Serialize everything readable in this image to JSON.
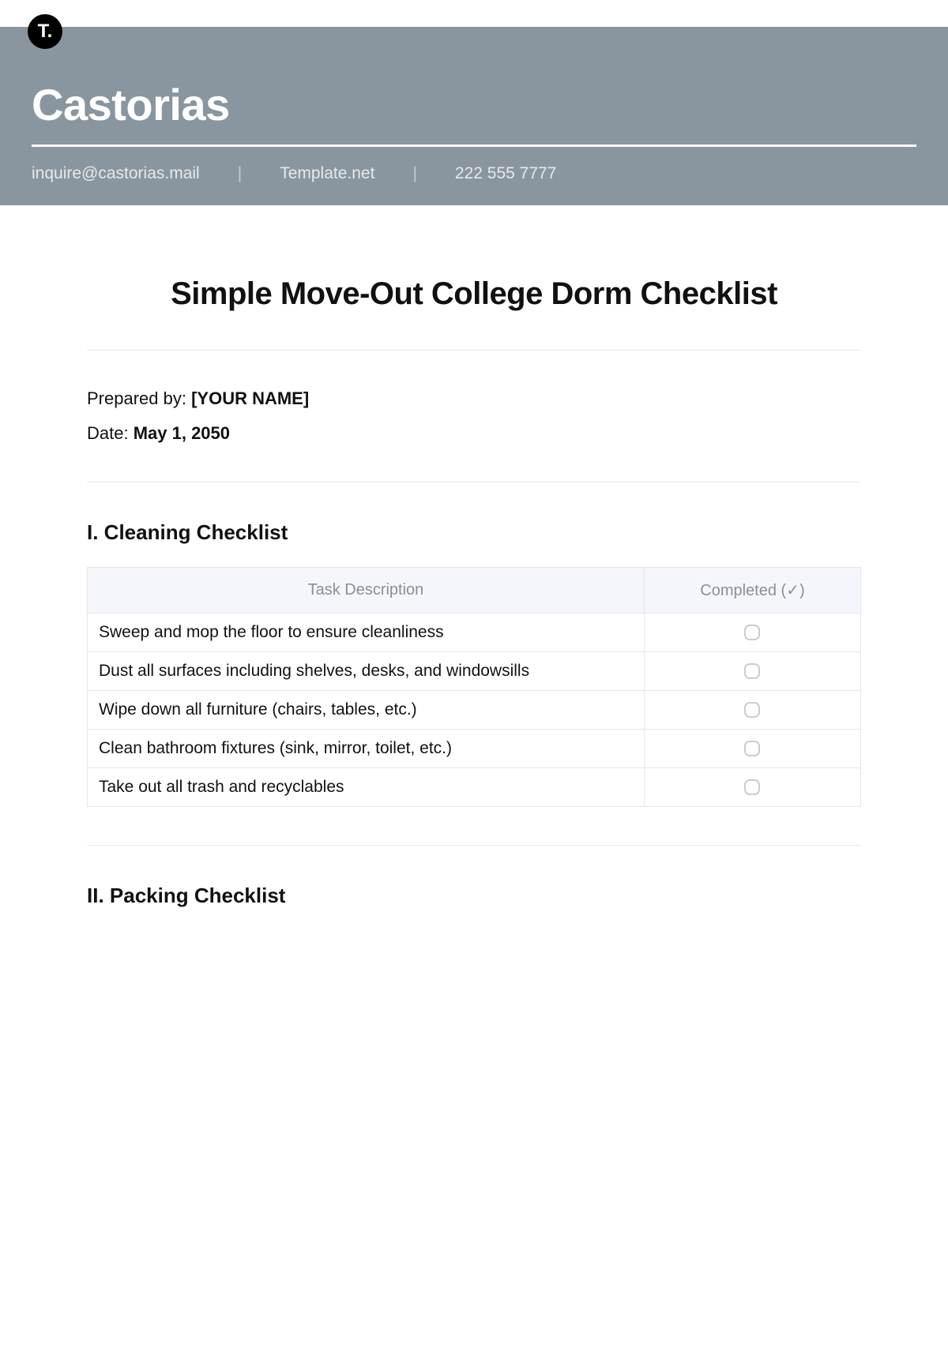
{
  "logo": {
    "text": "T."
  },
  "header": {
    "brand": "Castorias",
    "email": "inquire@castorias.mail",
    "website": "Template.net",
    "phone": "222 555 7777",
    "separator": "|"
  },
  "document": {
    "title": "Simple Move-Out College Dorm Checklist",
    "prepared_by_label": "Prepared by: ",
    "prepared_by_value": "[YOUR NAME]",
    "date_label": "Date: ",
    "date_value": "May 1, 2050"
  },
  "sections": {
    "cleaning": {
      "heading": "I. Cleaning Checklist",
      "columns": {
        "task": "Task Description",
        "completed": "Completed (✓)"
      },
      "rows": [
        {
          "task": "Sweep and mop the floor to ensure cleanliness"
        },
        {
          "task": "Dust all surfaces including shelves, desks, and windowsills"
        },
        {
          "task": "Wipe down all furniture (chairs, tables, etc.)"
        },
        {
          "task": "Clean bathroom fixtures (sink, mirror, toilet, etc.)"
        },
        {
          "task": "Take out all trash and recyclables"
        }
      ]
    },
    "packing": {
      "heading": "II. Packing Checklist"
    }
  }
}
